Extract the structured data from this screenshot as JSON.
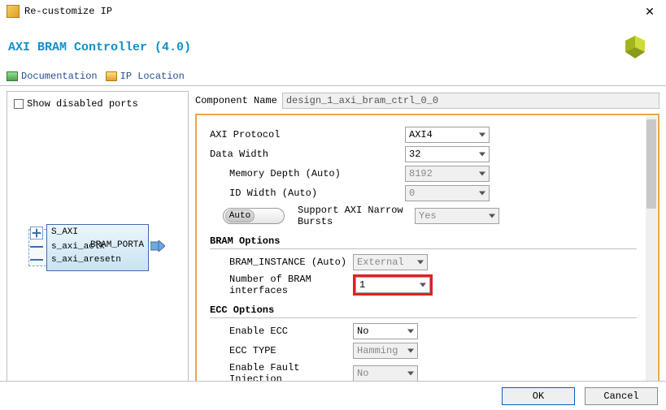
{
  "window": {
    "title": "Re-customize IP"
  },
  "ip_title": "AXI BRAM Controller (4.0)",
  "toolbar": {
    "documentation": "Documentation",
    "ip_location": "IP Location"
  },
  "show_disabled_label": "Show disabled ports",
  "block": {
    "pins_left": [
      "S_AXI",
      "s_axi_aclk",
      "s_axi_aresetn"
    ],
    "pins_right": [
      "BRAM_PORTA"
    ]
  },
  "component_name_label": "Component Name",
  "component_name_value": "design_1_axi_bram_ctrl_0_0",
  "config": {
    "axi_protocol": {
      "label": "AXI Protocol",
      "value": "AXI4"
    },
    "data_width": {
      "label": "Data Width",
      "value": "32"
    },
    "memory_depth": {
      "label": "Memory Depth (Auto)",
      "value": "8192"
    },
    "id_width": {
      "label": "ID Width (Auto)",
      "value": "0"
    },
    "narrow_bursts": {
      "toggle": "Auto",
      "label": "Support AXI Narrow Bursts",
      "value": "Yes"
    },
    "bram_header": "BRAM Options",
    "bram_instance": {
      "label": "BRAM_INSTANCE (Auto)",
      "value": "External"
    },
    "bram_interfaces": {
      "label": "Number of BRAM interfaces",
      "value": "1"
    },
    "ecc_header": "ECC Options",
    "enable_ecc": {
      "label": "Enable ECC",
      "value": "No"
    },
    "ecc_type": {
      "label": "ECC TYPE",
      "value": "Hamming"
    },
    "fault_inj": {
      "label": "Enable Fault Injection",
      "value": "No"
    }
  },
  "footer": {
    "ok": "OK",
    "cancel": "Cancel"
  }
}
